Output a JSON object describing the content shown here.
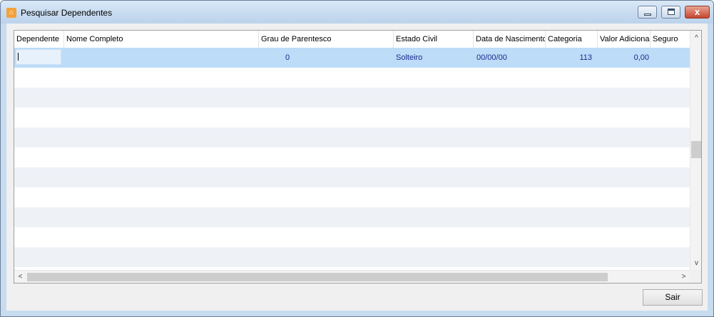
{
  "window": {
    "title": "Pesquisar Dependentes",
    "icon": "app-home-icon",
    "close_glyph": "x"
  },
  "grid": {
    "columns": [
      "Dependente",
      "Nome Completo",
      "Grau de Parentesco",
      "Estado Civil",
      "Data de Nascimento",
      "Categoria",
      "Valor Adicional",
      "Seguro"
    ],
    "rows": [
      {
        "dependente": "",
        "nome_completo": "",
        "grau_parentesco": "0",
        "estado_civil": "Solteiro",
        "data_nascimento": "00/00/00",
        "categoria": "113",
        "valor_adicional": "0,00",
        "seguro": ""
      }
    ],
    "scroll": {
      "up_arrow": "^",
      "down_arrow": "v",
      "left_arrow": "<",
      "right_arrow": ">"
    }
  },
  "buttons": {
    "sair": "Sair"
  },
  "colors": {
    "selected_row": "#bcdcf8",
    "alt_row": "#eef2f7",
    "cell_text": "#1a2a8a",
    "titlebar": "#c9dcf0"
  }
}
